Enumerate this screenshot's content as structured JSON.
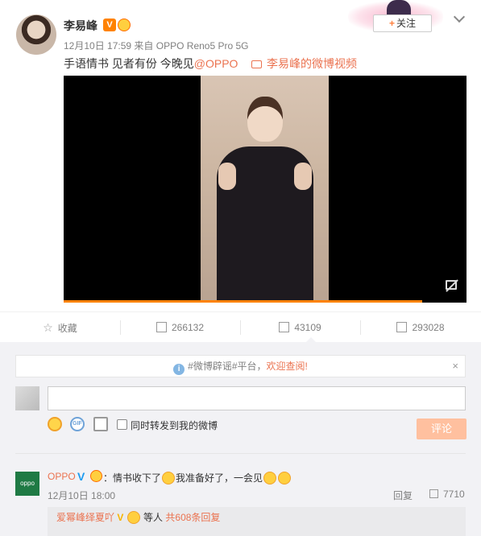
{
  "post": {
    "author": "李易峰",
    "verified_badge": "V",
    "timestamp": "12月10日 17:59",
    "source_prefix": "来自",
    "source": "OPPO Reno5 Pro 5G",
    "text": "手语情书 见者有份 今晚见",
    "mention": "@OPPO",
    "video_link": "李易峰的微博视频",
    "follow_label": "关注",
    "follow_plus": "+"
  },
  "video": {
    "progress_fraction": 0.89,
    "progress_color": "#ff8200"
  },
  "actions": {
    "favorite": "收藏",
    "repost_count": "266132",
    "comment_count": "43109",
    "like_count": "293028"
  },
  "comments": {
    "notice_text": "#微博辟谣#平台，",
    "notice_link": "欢迎查阅!",
    "notice_close": "×",
    "input_placeholder": "",
    "gif_label": "GIF",
    "repost_label": "同时转发到我的微博",
    "submit_label": "评论",
    "items": [
      {
        "avatar_text": "oppo",
        "name": "OPPO",
        "verified": "V",
        "text_a": "：情书收下了",
        "text_b": "我准备好了，一会见",
        "time": "12月10日 18:00",
        "reply_label": "回复",
        "likes": "7710",
        "sub_name": "爱幂峰绎夏吖",
        "sub_v": "V",
        "sub_mid": " 等人 ",
        "sub_more": "共608条回复"
      }
    ]
  },
  "colors": {
    "accent": "#eb7350",
    "brand_orange": "#ff8200",
    "submit_disabled": "#ffc09f",
    "page_bg": "#f2f2f5"
  }
}
